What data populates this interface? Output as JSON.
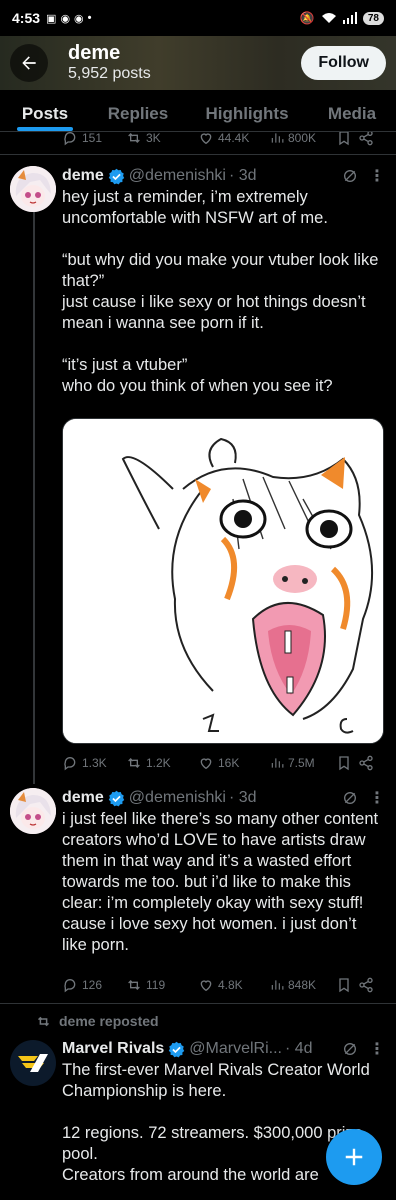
{
  "status_bar": {
    "time": "4:53",
    "battery": "78"
  },
  "header": {
    "name": "deme",
    "post_count": "5,952 posts",
    "follow_label": "Follow"
  },
  "tabs": [
    {
      "label": "Posts",
      "active": true
    },
    {
      "label": "Replies",
      "active": false
    },
    {
      "label": "Highlights",
      "active": false
    },
    {
      "label": "Media",
      "active": false
    }
  ],
  "top_partial_actions": {
    "replies": "151",
    "reposts": "3K",
    "likes": "44.4K",
    "views": "800K"
  },
  "tweets": [
    {
      "name": "deme",
      "handle": "@demenishki",
      "time": "· 3d",
      "text": "hey just a reminder, i’m extremely uncomfortable with NSFW art of me.\n\n“but why did you make your vtuber look like that?”\njust cause i like sexy or hot things doesn’t mean i wanna see porn if it.\n\n“it’s just a vtuber”\nwho do you think of when you see it?",
      "actions": {
        "replies": "1.3K",
        "reposts": "1.2K",
        "likes": "16K",
        "views": "7.5M"
      }
    },
    {
      "name": "deme",
      "handle": "@demenishki",
      "time": "· 3d",
      "text": "i just feel like there’s so many other content creators who’d LOVE to have artists draw them in that way and it’s a wasted effort towards me too. but i’d like to make this clear: i’m completely okay with sexy stuff! cause i love sexy hot women. i just don’t like porn.",
      "actions": {
        "replies": "126",
        "reposts": "119",
        "likes": "4.8K",
        "views": "848K"
      }
    },
    {
      "repost_label": "deme reposted",
      "name": "Marvel Rivals",
      "handle": "@MarvelRi...",
      "time": "· 4d",
      "text": "The first-ever Marvel Rivals Creator World Championship is here.\n\n12 regions. 72 streamers. $300,000 prize pool.\nCreators from around the world are"
    }
  ],
  "colors": {
    "accent": "#1d9bf0",
    "text": "#e7e9ea",
    "muted": "#71767b",
    "divider": "#2f3336"
  }
}
